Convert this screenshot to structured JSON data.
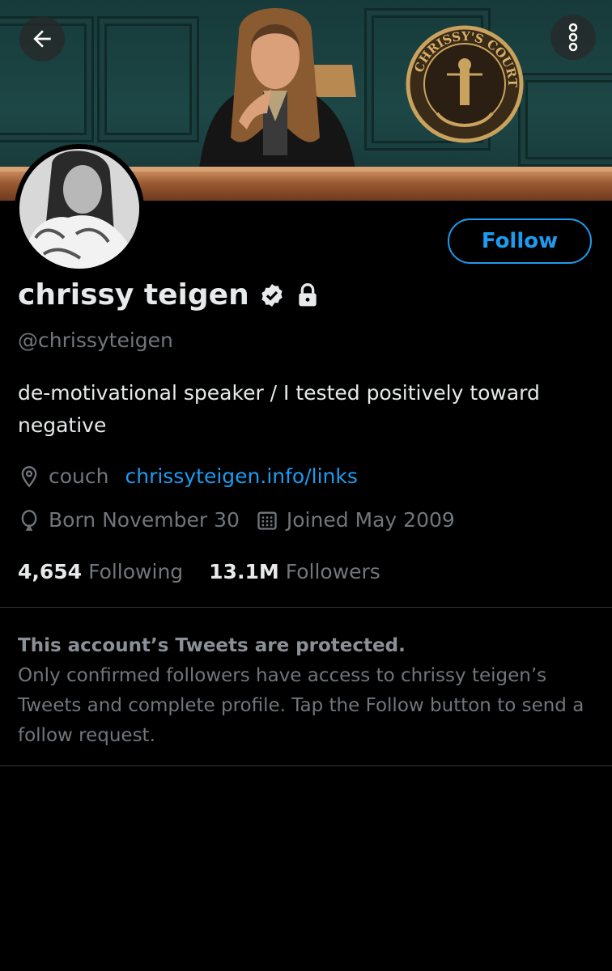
{
  "header": {
    "back_icon": "arrow-left-icon",
    "more_icon": "more-vertical-icon",
    "seal_text": "CHRISSY'S COURT"
  },
  "profile": {
    "name": "chrissy teigen",
    "handle": "@chrissyteigen",
    "bio": "de-motivational speaker / I tested positively toward negative",
    "location": "couch",
    "website": "chrissyteigen.info/links",
    "birthday": "Born November 30",
    "joined": "Joined May 2009",
    "following_count": "4,654",
    "following_label": "Following",
    "followers_count": "13.1M",
    "followers_label": "Followers"
  },
  "actions": {
    "follow_label": "Follow"
  },
  "protected_notice": {
    "title": "This account’s Tweets are protected.",
    "body": "Only confirmed followers have access to chrissy teigen’s Tweets and complete profile. Tap the Follow button to send a follow request."
  },
  "colors": {
    "accent": "#1d9bf0",
    "background": "#000000",
    "secondary_text": "#71767b"
  }
}
